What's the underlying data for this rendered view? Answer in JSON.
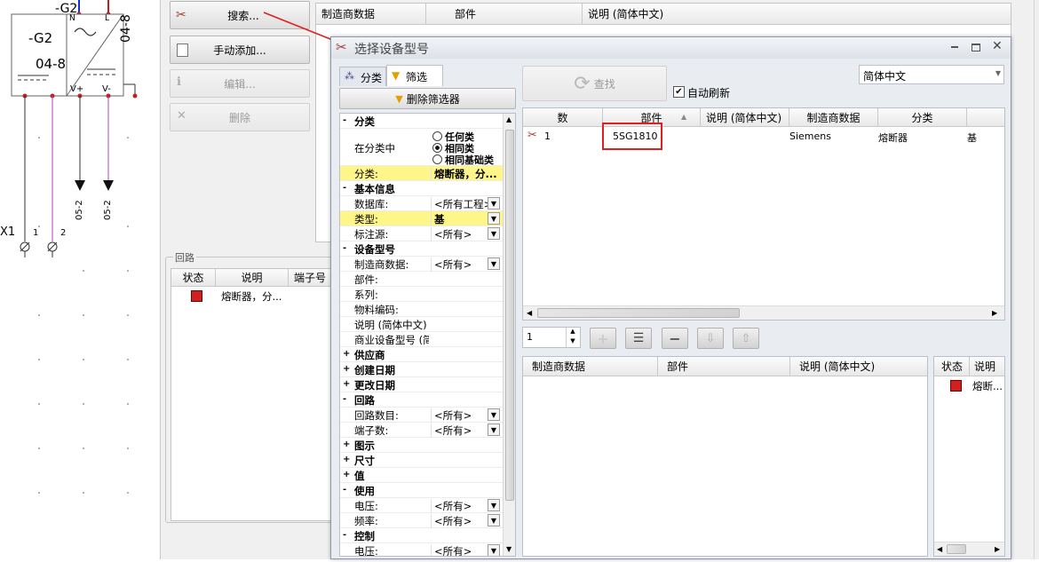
{
  "schematic": {
    "top_label": "-G2",
    "box_label": "-G2",
    "box_sub": "04-8",
    "vertical_label": "04-8",
    "pin_n": "N",
    "pin_l": "L",
    "pin_vplus": "V+",
    "pin_vminus": "V-",
    "arrow_label_1": "05-2",
    "arrow_label_2": "05-2",
    "terminal_label": "X1",
    "terminal_1": "1",
    "terminal_2": "2"
  },
  "background_panel": {
    "search_button": "搜索...",
    "manual_add_button": "手动添加...",
    "edit_button": "编辑...",
    "delete_button": "删除",
    "table_headers": [
      "制造商数据",
      "部件",
      "说明 (简体中文)"
    ],
    "circuit_group_label": "回路",
    "circuit_headers": [
      "状态",
      "说明",
      "端子号"
    ],
    "circuit_row_desc": "熔断器，分..."
  },
  "dialog": {
    "title": "选择设备型号",
    "tabs": [
      "分类",
      "筛选"
    ],
    "delete_filter_button": "删除筛选器",
    "search_button": "查找",
    "auto_refresh_label": "自动刷新",
    "auto_refresh_checked": true,
    "language_select": "简体中文",
    "filter": {
      "rows": [
        {
          "type": "group",
          "label": "分类",
          "open": "-"
        },
        {
          "type": "radio",
          "key": "在分类中",
          "options": [
            "任何类",
            "相同类",
            "相同基础类"
          ],
          "selected": 1
        },
        {
          "type": "prop",
          "key": "分类:",
          "value": "熔断器，分...",
          "highlight": true
        },
        {
          "type": "group",
          "label": "基本信息",
          "open": "-"
        },
        {
          "type": "prop",
          "key": "数据库:",
          "value": "<所有工程>",
          "dd": true
        },
        {
          "type": "prop",
          "key": "类型:",
          "value": "基",
          "dd": true,
          "highlight": true
        },
        {
          "type": "prop",
          "key": "标注源:",
          "value": "<所有>",
          "dd": true
        },
        {
          "type": "group",
          "label": "设备型号",
          "open": "-"
        },
        {
          "type": "prop",
          "key": "制造商数据:",
          "value": "<所有>",
          "dd": true
        },
        {
          "type": "prop",
          "key": "部件:",
          "value": ""
        },
        {
          "type": "prop",
          "key": "系列:",
          "value": ""
        },
        {
          "type": "prop",
          "key": "物料编码:",
          "value": ""
        },
        {
          "type": "prop",
          "key": "说明 (简体中文)",
          "value": ""
        },
        {
          "type": "prop",
          "key": "商业设备型号 (简",
          "value": ""
        },
        {
          "type": "group",
          "label": "供应商",
          "open": "+"
        },
        {
          "type": "group",
          "label": "创建日期",
          "open": "+"
        },
        {
          "type": "group",
          "label": "更改日期",
          "open": "+"
        },
        {
          "type": "group",
          "label": "回路",
          "open": "-"
        },
        {
          "type": "prop",
          "key": "回路数目:",
          "value": "<所有>",
          "dd": true
        },
        {
          "type": "prop",
          "key": "端子数:",
          "value": "<所有>",
          "dd": true
        },
        {
          "type": "group",
          "label": "图示",
          "open": "+"
        },
        {
          "type": "group",
          "label": "尺寸",
          "open": "+"
        },
        {
          "type": "group",
          "label": "值",
          "open": "+"
        },
        {
          "type": "group",
          "label": "使用",
          "open": "-"
        },
        {
          "type": "prop",
          "key": "电压:",
          "value": "<所有>",
          "dd": true
        },
        {
          "type": "prop",
          "key": "频率:",
          "value": "<所有>",
          "dd": true
        },
        {
          "type": "group",
          "label": "控制",
          "open": "-"
        },
        {
          "type": "prop",
          "key": "电压:",
          "value": "<所有>",
          "dd": true
        }
      ]
    },
    "results": {
      "headers": [
        "数",
        "部件",
        "说明 (简体中文)",
        "制造商数据",
        "分类"
      ],
      "rows": [
        {
          "num": "1",
          "part": "5SG1810",
          "desc": "",
          "manufacturer": "Siemens",
          "category": "熔断器",
          "type": "基"
        }
      ]
    },
    "quantity_value": "1",
    "bottom_table_headers": [
      "制造商数据",
      "部件",
      "说明 (简体中文)"
    ],
    "right_table_headers": [
      "状态",
      "说明"
    ],
    "right_table_row": "熔断..."
  },
  "colors": {
    "highlight_yellow": "#fff68a",
    "callout_red": "#e02020",
    "wire_purple": "#b040b0"
  }
}
